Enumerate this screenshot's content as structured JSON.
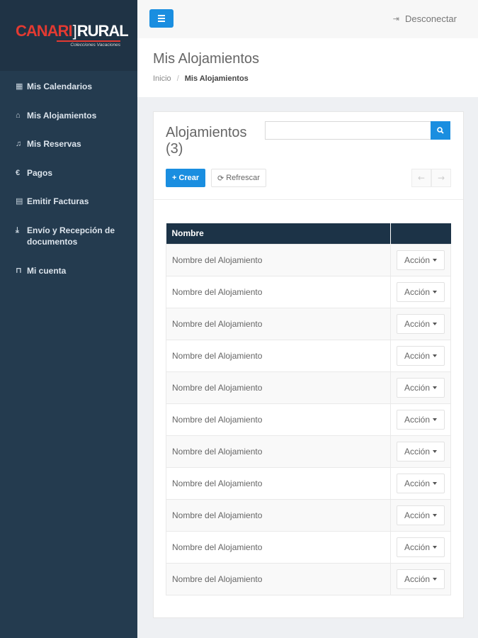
{
  "logo": {
    "part1": "CANARI",
    "part2": "RURAL",
    "subtitle": "Colecciones Vacaciones"
  },
  "sidebar": {
    "items": [
      {
        "icon": "calendar-icon",
        "glyph": "▦",
        "label": "Mis Calendarios"
      },
      {
        "icon": "home-icon",
        "glyph": "⌂",
        "label": "Mis Alojamientos"
      },
      {
        "icon": "bell-icon",
        "glyph": "♫",
        "label": "Mis Reservas"
      },
      {
        "icon": "euro-icon",
        "glyph": "€",
        "label": "Pagos"
      },
      {
        "icon": "invoice-icon",
        "glyph": "▤",
        "label": "Emitir Facturas"
      },
      {
        "icon": "download-icon",
        "glyph": "⤓",
        "label": "Envío y Recepción de documentos"
      },
      {
        "icon": "lock-icon",
        "glyph": "⊓",
        "label": "Mi cuenta"
      }
    ]
  },
  "topbar": {
    "logout_label": "Desconectar"
  },
  "page": {
    "title": "Mis Alojamientos",
    "breadcrumb": {
      "home": "Inicio",
      "separator": "/",
      "current": "Mis Alojamientos"
    }
  },
  "card": {
    "title": "Alojamientos (3)",
    "search_value": "",
    "crear_label": "Crear",
    "refrescar_label": "Refrescar",
    "prev_glyph": "←",
    "next_glyph": "→"
  },
  "table": {
    "headers": [
      "Nombre",
      ""
    ],
    "action_label": "Acción",
    "rows": [
      "Nombre del Alojamiento",
      "Nombre del Alojamiento",
      "Nombre del Alojamiento",
      "Nombre del Alojamiento",
      "Nombre del Alojamiento",
      "Nombre del Alojamiento",
      "Nombre del Alojamiento",
      "Nombre del Alojamiento",
      "Nombre del Alojamiento",
      "Nombre del Alojamiento",
      "Nombre del Alojamiento"
    ]
  },
  "colors": {
    "accent": "#1a8ee0",
    "sidebar": "#243b4f",
    "table_header": "#1c3347",
    "brand_red": "#e23a32"
  }
}
